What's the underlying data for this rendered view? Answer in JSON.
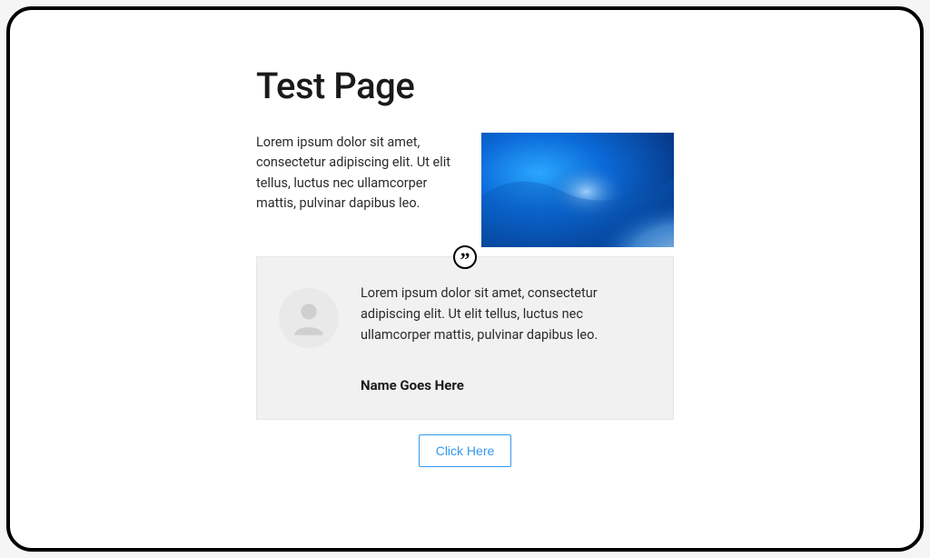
{
  "header": {
    "title": "Test Page"
  },
  "intro": {
    "text": "Lorem ipsum dolor sit amet, consectetur adipiscing elit. Ut elit tellus, luctus nec ullamcorper mattis, pulvinar dapibus leo."
  },
  "testimonial": {
    "text": "Lorem ipsum dolor sit amet, consectetur adipiscing elit. Ut elit tellus, luctus nec ullamcorper mattis, pulvinar dapibus leo.",
    "name": "Name Goes Here"
  },
  "cta": {
    "label": "Click Here"
  },
  "colors": {
    "accent": "#339af0",
    "panel": "#f1f1f1"
  }
}
